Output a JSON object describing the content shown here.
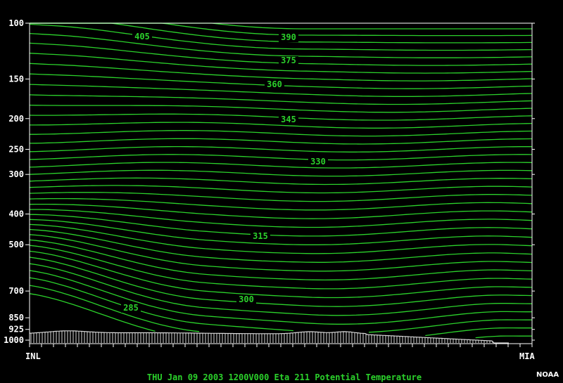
{
  "credit": "NOAA",
  "chart_data": {
    "type": "line",
    "title": "THU Jan 09 2003 1200V000 Eta 211 Potential Temperature",
    "y_axis": {
      "scale": "log-pressure",
      "reversed": true,
      "range": [
        100,
        1000
      ],
      "tick_labels": [
        "100",
        "150",
        "200",
        "250",
        "300",
        "400",
        "500",
        "700",
        "850",
        "925",
        "1000"
      ]
    },
    "x_axis": {
      "start_label": "INL",
      "end_label": "MIA"
    },
    "contour_labels": [
      "405",
      "390",
      "375",
      "360",
      "345",
      "330",
      "315",
      "300",
      "285"
    ],
    "contour_interval_K": 3,
    "colors": {
      "contour": "#2bd12b",
      "axes": "#ffffff",
      "terrain": "#d8d8d8",
      "background": "#000000"
    }
  }
}
